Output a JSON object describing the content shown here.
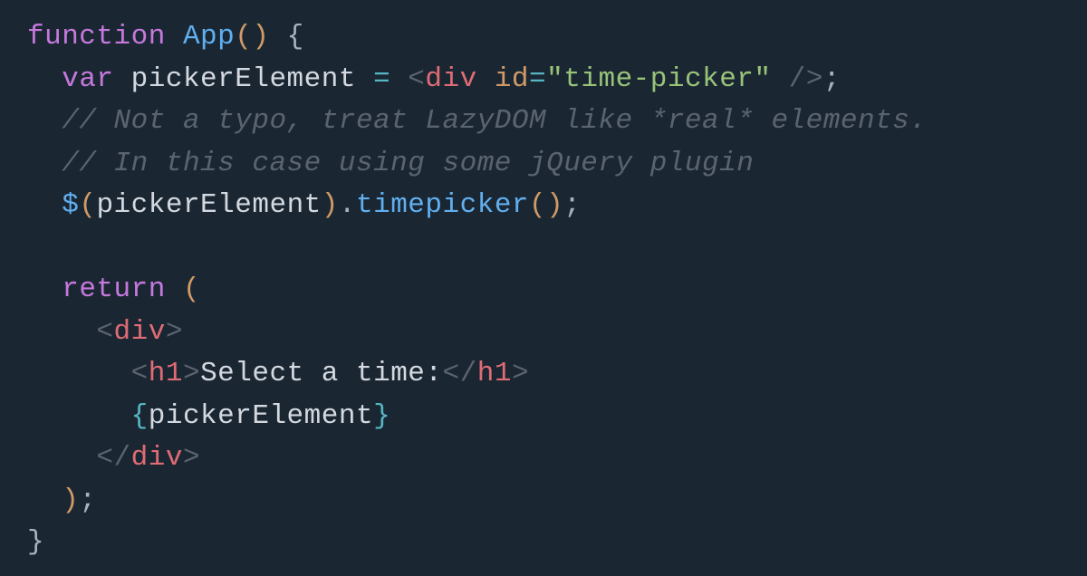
{
  "code": {
    "line1": {
      "function": "function",
      "name": "App",
      "parens": "()",
      "brace": " {"
    },
    "line2": {
      "indent": "  ",
      "var": "var",
      "varname": " pickerElement ",
      "equals": "=",
      "space": " ",
      "open": "<",
      "tag": "div",
      "attrSpace": " ",
      "attr": "id",
      "eq": "=",
      "quote1": "\"",
      "str": "time-picker",
      "quote2": "\"",
      "close": " />",
      "semi": ";"
    },
    "line3": {
      "indent": "  ",
      "comment": "// Not a typo, treat LazyDOM like *real* elements."
    },
    "line4": {
      "indent": "  ",
      "comment": "// In this case using some jQuery plugin"
    },
    "line5": {
      "indent": "  ",
      "dollar": "$",
      "open": "(",
      "arg": "pickerElement",
      "close": ")",
      "dot": ".",
      "method": "timepicker",
      "parens": "()",
      "semi": ";"
    },
    "line6": "",
    "line7": {
      "indent": "  ",
      "return": "return",
      "space": " ",
      "paren": "("
    },
    "line8": {
      "indent": "    ",
      "open": "<",
      "tag": "div",
      "close": ">"
    },
    "line9": {
      "indent": "      ",
      "open1": "<",
      "tag1": "h1",
      "close1": ">",
      "text": "Select a time:",
      "open2": "</",
      "tag2": "h1",
      "close2": ">"
    },
    "line10": {
      "indent": "      ",
      "open": "{",
      "expr": "pickerElement",
      "close": "}"
    },
    "line11": {
      "indent": "    ",
      "open": "</",
      "tag": "div",
      "close": ">"
    },
    "line12": {
      "indent": "  ",
      "paren": ")",
      "semi": ";"
    },
    "line13": {
      "brace": "}"
    }
  }
}
